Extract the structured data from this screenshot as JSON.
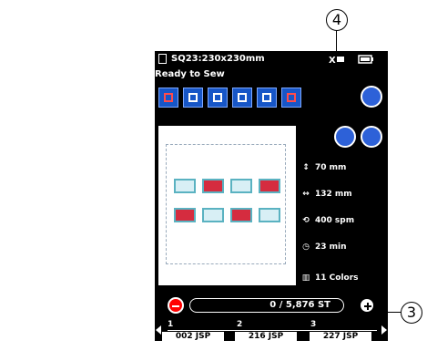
{
  "title_bar": {
    "title": "SQ23:230x230mm",
    "status_left": "Ready to Sew",
    "speed_icon_text": "X",
    "battery_icon": "battery-icon"
  },
  "measurements": {
    "height": "70 mm",
    "width": "132 mm",
    "speed": "400 spm",
    "time": "23 min",
    "colors": "11 Colors"
  },
  "counter": {
    "value": "0 / 5,876 ST"
  },
  "segments": {
    "labels": [
      "1",
      "2",
      "3"
    ],
    "values": [
      "002 JSP",
      "216 JSP",
      "227 JSP"
    ]
  },
  "callouts": {
    "top": "4",
    "right": "3"
  }
}
